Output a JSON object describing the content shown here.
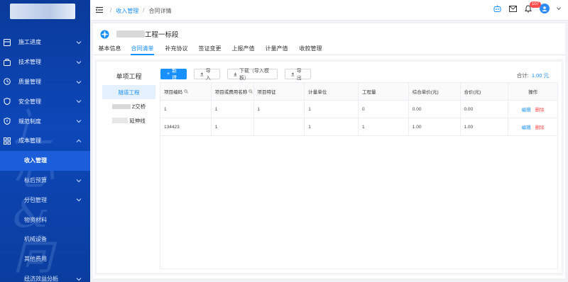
{
  "sidebar": {
    "items": [
      {
        "label": "施工进度",
        "icon": "grid-icon",
        "expanded": false
      },
      {
        "label": "技术管理",
        "icon": "briefcase-icon",
        "expanded": false
      },
      {
        "label": "质量管理",
        "icon": "clock-icon",
        "expanded": false
      },
      {
        "label": "安全管理",
        "icon": "shield-icon",
        "expanded": false
      },
      {
        "label": "规范制度",
        "icon": "shield-icon",
        "expanded": false
      },
      {
        "label": "成本管理",
        "icon": "apps-icon",
        "expanded": true
      },
      {
        "label": "收入管理",
        "sub": true,
        "active": true
      },
      {
        "label": "标后预算",
        "sub": true,
        "arrow": true
      },
      {
        "label": "分包管理",
        "sub": true,
        "arrow": true
      },
      {
        "label": "物资材料",
        "sub": true
      },
      {
        "label": "机械设备",
        "sub": true
      },
      {
        "label": "其他费用",
        "sub": true
      },
      {
        "label": "经济效益分析",
        "sub": true,
        "arrow": true
      }
    ]
  },
  "header": {
    "breadcrumb_link": "收入管理",
    "breadcrumb_current": "合同详情",
    "sep": "/",
    "notification_count": "107"
  },
  "project": {
    "title_suffix": "工程一标段"
  },
  "tabs": [
    "基本信息",
    "合同清单",
    "补充协议",
    "签证变更",
    "上报产值",
    "计量产值",
    "收款管理"
  ],
  "active_tab": 1,
  "subpanel": {
    "title": "单项工程",
    "items": [
      {
        "label": "隧道工程",
        "active": true
      },
      {
        "label": "Z交桥"
      },
      {
        "label": "延伸线"
      }
    ]
  },
  "toolbar": {
    "new_label": "新建",
    "import_label": "导入",
    "download_label": "下载（导入模板）",
    "export_label": "导出"
  },
  "total": {
    "label": "合计:",
    "amount": "1.00 元"
  },
  "table": {
    "headers": [
      "项目编码",
      "项目或费用名称",
      "项目特征",
      "计量单位",
      "工程量",
      "综合单价(元)",
      "合价(元)",
      "操作"
    ],
    "rows": [
      [
        "1",
        "1",
        "1",
        "1",
        "0",
        "0.00",
        "0.00"
      ],
      [
        "134423",
        "1",
        "",
        "1",
        "1",
        "1.00",
        "1.00"
      ]
    ],
    "edit_label": "编辑",
    "delete_label": "删除"
  },
  "colors": {
    "sidebar_bg": "#0d47b8",
    "accent": "#1890ff",
    "danger": "#ff4d4f"
  }
}
